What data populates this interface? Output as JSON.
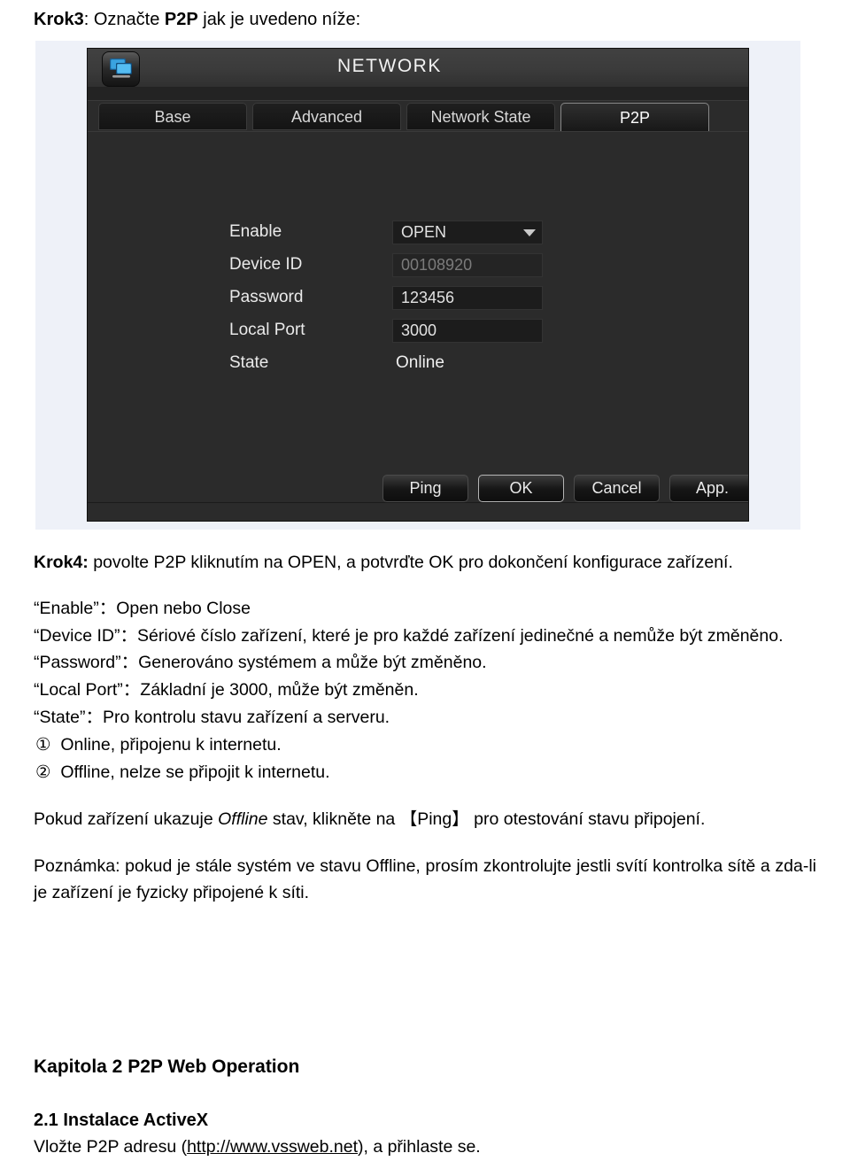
{
  "document": {
    "krok3": {
      "label": "Krok3",
      "sep": ": ",
      "text_a": "Označte ",
      "emphasis": "P2P",
      "text_b": " jak je uvedeno níže:"
    },
    "krok4": {
      "label": "Krok4:",
      "text": " povolte P2P kliknutím na OPEN, a potvrďte OK pro dokončení konfigurace zařízení."
    },
    "definitions": [
      {
        "term": "“Enable”：",
        "desc": "Open nebo Close"
      },
      {
        "term": "“Device ID”：",
        "desc": "Sériové číslo zařízení, které je pro každé zařízení jedinečné a nemůže být změněno."
      },
      {
        "term": "“Password”：",
        "desc": "Generováno systémem a může být změněno."
      },
      {
        "term": "“Local Port”：",
        "desc": "Základní je 3000, může být změněn."
      },
      {
        "term": "“State”：",
        "desc": "Pro kontrolu stavu zařízení a serveru."
      }
    ],
    "state_items": [
      {
        "marker": "①",
        "text": "Online, připojenu k internetu."
      },
      {
        "marker": "②",
        "text": "Offline, nelze se připojit k internetu."
      }
    ],
    "ping_note": {
      "before": "Pokud zařízení ukazuje ",
      "italic": "Offline",
      "middle": " stav, klikněte na ",
      "bracket": "【Ping】",
      "after": " pro otestování stavu připojení."
    },
    "poznamka": "Poznámka: pokud je stále systém ve stavu Offline, prosím zkontrolujte jestli svítí kontrolka sítě a zda-li je zařízení je fyzicky připojené k síti.",
    "chapter_heading": "Kapitola 2 P2P Web Operation",
    "section_heading": "2.1 Instalace ActiveX",
    "section_body": {
      "before": "Vložte P2P adresu (",
      "link": "http://www.vssweb.net",
      "after": "), a přihlaste se."
    }
  },
  "dvr": {
    "title": "NETWORK",
    "icon": "network-monitor-icon",
    "tabs": [
      {
        "label": "Base",
        "active": false
      },
      {
        "label": "Advanced",
        "active": false
      },
      {
        "label": "Network State",
        "active": false
      },
      {
        "label": "P2P",
        "active": true
      }
    ],
    "fields": [
      {
        "label": "Enable",
        "value": "OPEN",
        "type": "select",
        "dim": false
      },
      {
        "label": "Device ID",
        "value": "00108920",
        "type": "readonly",
        "dim": true
      },
      {
        "label": "Password",
        "value": "123456",
        "type": "input",
        "dim": false
      },
      {
        "label": "Local Port",
        "value": "3000",
        "type": "input",
        "dim": false
      },
      {
        "label": "State",
        "value": "Online",
        "type": "static",
        "dim": false
      }
    ],
    "buttons": [
      {
        "label": "Ping",
        "focused": false
      },
      {
        "label": "OK",
        "focused": true
      },
      {
        "label": "Cancel",
        "focused": false
      },
      {
        "label": "App.",
        "focused": false
      }
    ],
    "colors": {
      "panel_bg": "#2b2b2b",
      "titlebar": "#3b3b3b",
      "field_bg": "#1c1c1c",
      "text": "#eaeaea",
      "dim_text": "#7b7b7b",
      "frame_bg": "#eef1f8"
    }
  }
}
